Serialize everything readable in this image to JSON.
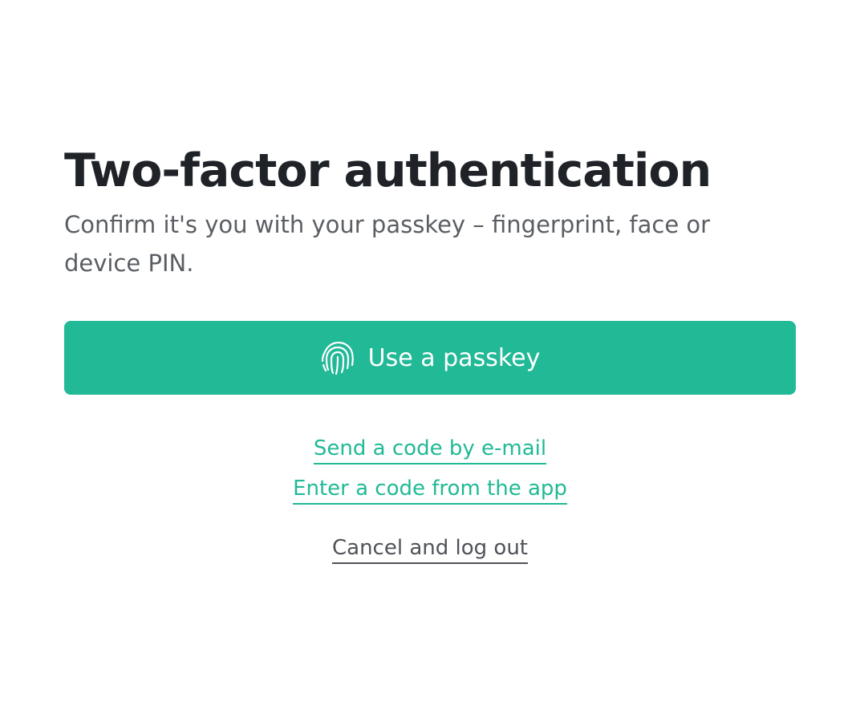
{
  "title": "Two-factor authentication",
  "subtitle": "Confirm it's you with your passkey – fingerprint, face or device PIN.",
  "primary_button": {
    "label": "Use a passkey",
    "icon": "fingerprint-icon",
    "color": "#21b996"
  },
  "links": {
    "email_code": "Send a code by e-mail",
    "app_code": "Enter a code from the app",
    "cancel": "Cancel and log out"
  },
  "colors": {
    "accent": "#21b996",
    "heading": "#1f2328",
    "body_text": "#5a5e63"
  }
}
